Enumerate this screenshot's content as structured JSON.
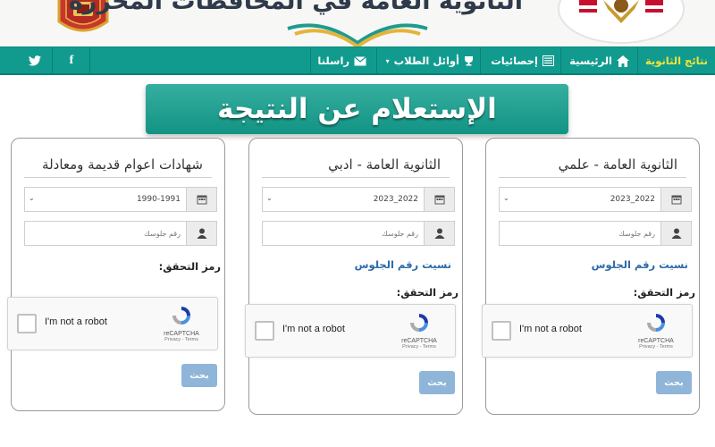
{
  "header": {
    "title": "الثانوية العامة في المحافظات المحررة"
  },
  "navbar": {
    "items": [
      {
        "label": "نتائج الثانوية",
        "icon": "",
        "active": true
      },
      {
        "label": "الرئيسية",
        "icon": "home-icon"
      },
      {
        "label": "إحصائيات",
        "icon": "stats-icon"
      },
      {
        "label": "أوائل الطلاب",
        "icon": "trophy-icon"
      },
      {
        "label": "راسلنا",
        "icon": "envelope-icon"
      }
    ],
    "social": [
      {
        "name": "facebook",
        "glyph": "f"
      },
      {
        "name": "twitter",
        "glyph": "twitter"
      }
    ]
  },
  "page_title": "الإستعلام عن النتيجة",
  "cards": [
    {
      "title": "الثانوية العامة - علمي",
      "year_value": "2023_2022",
      "seat_placeholder": "رقم جلوسك",
      "forgot_link": "نسيت رقم الجلوس",
      "verify_label": "رمز التحقق:",
      "captcha_text": "I'm not a robot",
      "captcha_brand": "reCAPTCHA",
      "captcha_terms": "Privacy - Terms",
      "search_label": "بحث"
    },
    {
      "title": "الثانوية العامة - ادبي",
      "year_value": "2023_2022",
      "seat_placeholder": "رقم جلوسك",
      "forgot_link": "نسيت رقم الجلوس",
      "verify_label": "رمز التحقق:",
      "captcha_text": "I'm not a robot",
      "captcha_brand": "reCAPTCHA",
      "captcha_terms": "Privacy - Terms",
      "search_label": "بحث"
    },
    {
      "title": "شهادات اعوام قديمة ومعادلة",
      "year_value": "1990-1991",
      "seat_placeholder": "رقم جلوسك",
      "verify_label": "رمز التحقق:",
      "captcha_text": "I'm not a robot",
      "captcha_brand": "reCAPTCHA",
      "captcha_terms": "Privacy - Terms",
      "search_label": "بحث"
    }
  ],
  "colors": {
    "navbar": "#119b8f",
    "ribbon": "#13a08f",
    "active_nav": "#f1e43a",
    "link": "#2b6aa8",
    "button": "#8fb5d9"
  }
}
